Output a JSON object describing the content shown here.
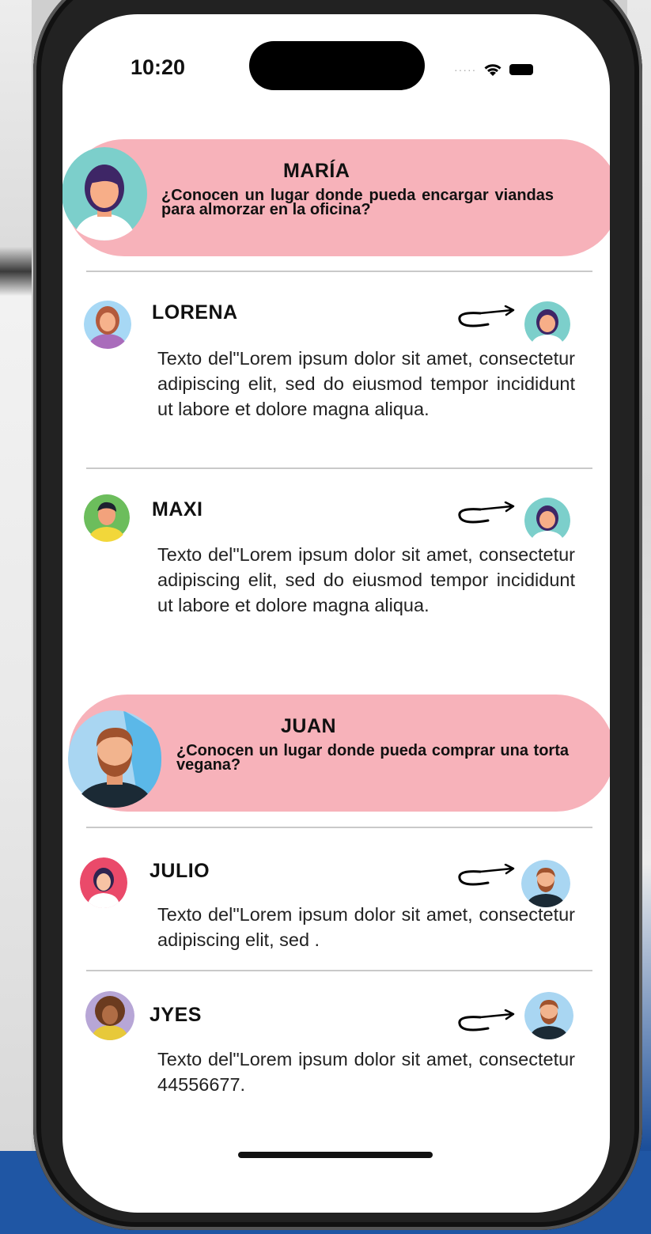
{
  "status_bar": {
    "time": "10:20"
  },
  "questions": [
    {
      "author": "MARÍA",
      "text": "¿Conocen un lugar donde pueda encargar viandas para almorzar en la oficina?",
      "avatar": "woman-teal-avatar"
    },
    {
      "author": "JUAN",
      "text": "¿Conocen un lugar donde pueda comprar una torta vegana?",
      "avatar": "bearded-man-avatar"
    }
  ],
  "replies": [
    {
      "author": "LORENA",
      "text": "Texto del\"Lorem ipsum dolor sit amet, consectetur adipiscing elit, sed do eiusmod tempor incididunt ut labore et dolore magna aliqua.",
      "reply_to_avatar": "woman-teal-avatar"
    },
    {
      "author": "MAXI",
      "text": "Texto del\"Lorem ipsum dolor sit amet, consectetur adipiscing elit, sed do eiusmod tempor incididunt ut labore et dolore magna aliqua.",
      "reply_to_avatar": "woman-teal-avatar"
    },
    {
      "author": "JULIO",
      "text": "Texto del\"Lorem ipsum dolor sit amet, consectetur adipiscing elit, sed .",
      "reply_to_avatar": "bearded-man-avatar"
    },
    {
      "author": "JYES",
      "text": "Texto del\"Lorem ipsum dolor sit amet, consectetur 44556677.",
      "reply_to_avatar": "bearded-man-avatar"
    }
  ],
  "colors": {
    "bubble": "#f7b2ba",
    "divider": "#c9c9c9"
  }
}
